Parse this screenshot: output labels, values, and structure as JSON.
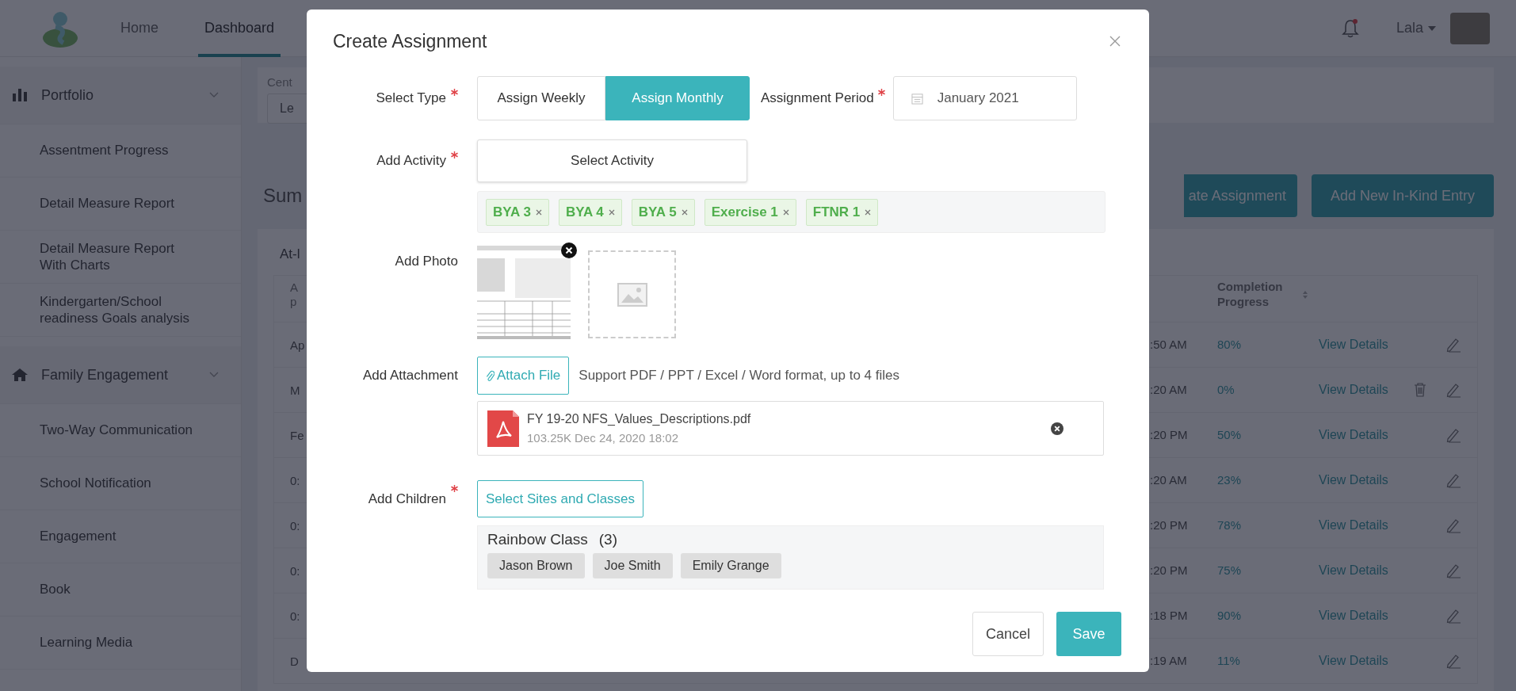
{
  "header": {
    "nav": [
      {
        "label": "Home",
        "selected": false
      },
      {
        "label": "Dashboard",
        "selected": true
      }
    ],
    "notifications": {
      "unread": true
    },
    "user": {
      "name": "Lala"
    }
  },
  "sidebar": {
    "groups": [
      {
        "label": "Portfolio",
        "kind": "chart",
        "expanded": true,
        "items": [
          "Assentment Progress",
          "Detail Measure Report",
          "Detail Measure Report With Charts",
          "Kindergarten/School readiness Goals analysis"
        ]
      },
      {
        "label": "Family Engagement",
        "kind": "home",
        "expanded": true,
        "items": [
          "Two-Way Communication",
          "School Notification",
          "Engagement",
          "Book",
          "Learning Media"
        ]
      }
    ]
  },
  "background": {
    "filter_label": "Cent",
    "filter_value": "Le",
    "section_title": "Sum",
    "buttons": [
      "ate Assignment",
      "Add New In-Kind Entry"
    ],
    "card_title": "At-l",
    "columns": {
      "column_1": [
        "A",
        "p"
      ],
      "completion": "Completion Progress"
    },
    "rows": [
      {
        "column_1": "Ap",
        "time": ":50 AM",
        "progress": "80%",
        "link": "View Details",
        "deletable": false
      },
      {
        "column_1": "M",
        "time": ":20 AM",
        "progress": "0%",
        "link": "View Details",
        "deletable": true
      },
      {
        "column_1": "Fe",
        "time": ":20 PM",
        "progress": "50%",
        "link": "View Details",
        "deletable": false
      },
      {
        "column_1": "0:",
        "time": ":20 AM",
        "progress": "23%",
        "link": "View Details",
        "deletable": false
      },
      {
        "column_1": "0:",
        "time": ":20 PM",
        "progress": "78%",
        "link": "View Details",
        "deletable": false
      },
      {
        "column_1": "0:",
        "time": ":20 PM",
        "progress": "75%",
        "link": "View Details",
        "deletable": false
      },
      {
        "column_1": "0:",
        "time": ":18 PM",
        "progress": "90%",
        "link": "View Details",
        "deletable": false
      },
      {
        "column_1": "D",
        "time": ":19 AM",
        "progress": "11%",
        "link": "View Details",
        "deletable": false
      }
    ]
  },
  "modal": {
    "title": "Create Assignment",
    "type": {
      "label": "Select Type",
      "required": true,
      "options": [
        {
          "label": "Assign Weekly",
          "selected": false
        },
        {
          "label": "Assign Monthly",
          "selected": true
        }
      ]
    },
    "period": {
      "label": "Assignment Period",
      "required": true,
      "value": "January 2021"
    },
    "activity": {
      "label": "Add Activity",
      "required": true,
      "button": "Select Activity",
      "tags": [
        "BYA 3",
        "BYA 4",
        "BYA 5",
        "Exercise 1",
        "FTNR 1"
      ]
    },
    "photo": {
      "label": "Add Photo"
    },
    "attachment": {
      "label": "Add Attachment",
      "button": "Attach File",
      "hint": "Support PDF / PPT / Excel / Word format, up to 4 files",
      "files": [
        {
          "name": "FY 19-20 NFS_Values_Descriptions.pdf",
          "meta": "103.25K Dec 24, 2020 18:02"
        }
      ]
    },
    "students": {
      "label": "Add Children",
      "required": true,
      "button": "Select Sites and Classes",
      "classes": [
        {
          "name": "Rainbow Class",
          "count": "(3)",
          "members": [
            "Jason Brown",
            "Joe Smith",
            "Emily Grange"
          ]
        }
      ]
    },
    "actions": {
      "cancel": "Cancel",
      "save": "Save"
    }
  }
}
